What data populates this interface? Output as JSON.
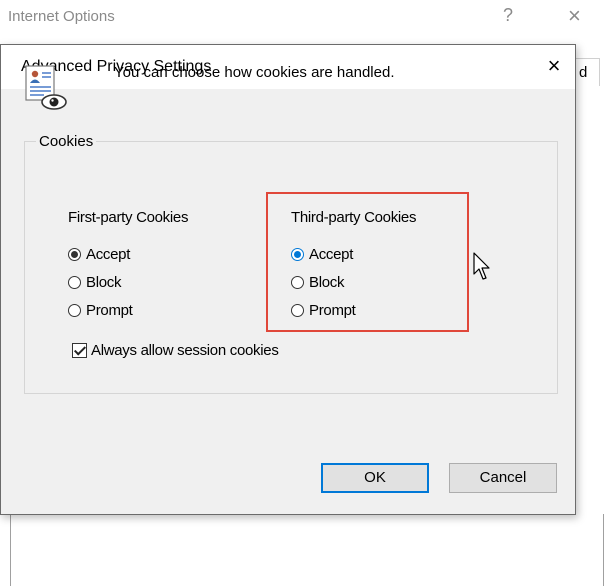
{
  "background_window": {
    "title": "Internet Options",
    "help_label": "?",
    "close_label": "×",
    "tab_label": "d"
  },
  "dialog": {
    "title": "Advanced Privacy Settings",
    "close_label": "×",
    "intro_text": "You can choose how cookies are handled.",
    "group_label": "Cookies",
    "first_party": {
      "title": "First-party Cookies",
      "options": [
        "Accept",
        "Block",
        "Prompt"
      ],
      "selected": "Accept"
    },
    "third_party": {
      "title": "Third-party Cookies",
      "options": [
        "Accept",
        "Block",
        "Prompt"
      ],
      "selected": "Accept"
    },
    "session_cookies": {
      "label": "Always allow session cookies",
      "checked": true
    },
    "buttons": {
      "ok": "OK",
      "cancel": "Cancel"
    }
  },
  "colors": {
    "highlight_box": "#e0473a",
    "accent": "#0078d7",
    "dialog_bg": "#f0f0f0"
  },
  "icons": [
    "privacy-report-icon",
    "close-icon",
    "mouse-pointer-icon"
  ]
}
